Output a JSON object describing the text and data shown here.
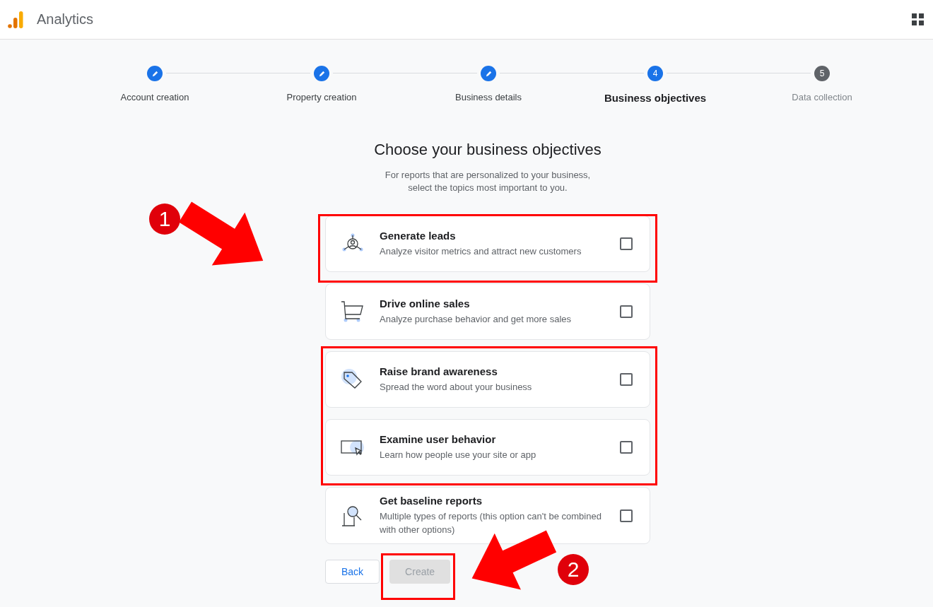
{
  "header": {
    "title": "Analytics"
  },
  "steps": [
    {
      "label": "Account creation",
      "kind": "done"
    },
    {
      "label": "Property creation",
      "kind": "done"
    },
    {
      "label": "Business details",
      "kind": "done"
    },
    {
      "label": "Business objectives",
      "kind": "current",
      "number": "4"
    },
    {
      "label": "Data collection",
      "kind": "upcoming",
      "number": "5"
    }
  ],
  "heading": "Choose your business objectives",
  "subtitle": [
    "For reports that are personalized to your business,",
    "select the topics most important to you."
  ],
  "objectives": [
    {
      "kind": "leads",
      "title": "Generate leads",
      "description": "Analyze visitor metrics and attract new customers",
      "checked": false
    },
    {
      "kind": "sales",
      "title": "Drive online sales",
      "description": "Analyze purchase behavior and get more sales",
      "checked": false
    },
    {
      "kind": "brand",
      "title": "Raise brand awareness",
      "description": "Spread the word about your business",
      "checked": false
    },
    {
      "kind": "behavior",
      "title": "Examine user behavior",
      "description": "Learn how people use your site or app",
      "checked": false
    },
    {
      "kind": "baseline",
      "title": "Get baseline reports",
      "description": "Multiple types of reports (this option can't be combined with other options)",
      "checked": false
    }
  ],
  "buttons": {
    "back": "Back",
    "create": "Create",
    "create_disabled": true
  },
  "annotations": {
    "markers": [
      "1",
      "2"
    ]
  }
}
